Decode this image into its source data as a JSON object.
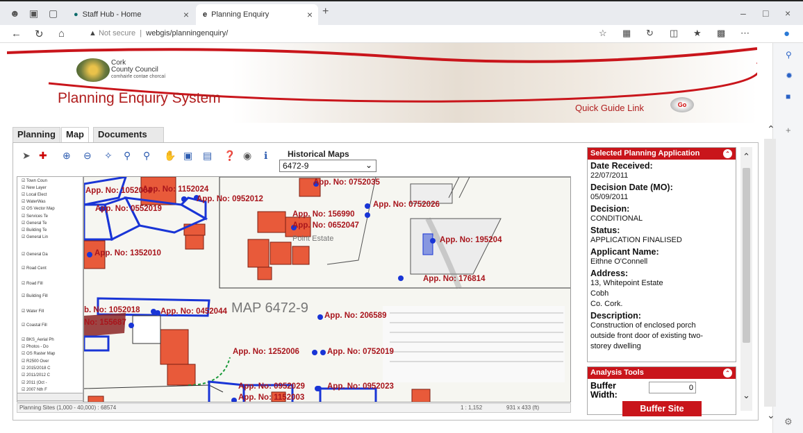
{
  "browser": {
    "tabs": [
      {
        "title": "Staff Hub - Home"
      },
      {
        "title": "Planning Enquiry"
      }
    ],
    "new_tab": "+",
    "security": "Not secure",
    "url": "webgis/planningenquiry/"
  },
  "header": {
    "org_line1": "Cork",
    "org_line2": "County Council",
    "org_irish": "comhairle contae chorcaí",
    "title": "Planning Enquiry System",
    "guide_link": "Quick Guide Link",
    "go": "Go"
  },
  "tabs": {
    "planning": "Planning",
    "map": "Map",
    "documents": "Documents"
  },
  "historical": {
    "label": "Historical Maps",
    "selected": "6472-9"
  },
  "layers": [
    "Town Coun",
    "New Layer",
    "Local Elect",
    "WaterWas",
    "OS Vector Map",
    "Services Te",
    "General Te",
    "Building Te",
    "General Lin",
    "General Da",
    "Road Cent",
    "Road Fill",
    "Building Fill",
    "Water Fill",
    "Coastal Fill",
    "BKS_Aerial Ph",
    "Photos - Do",
    "OS Raster Map",
    "R2500 Over",
    "2015/2018 C",
    "2011/2012 C",
    "2011 (Oct -",
    "2007 Nth F"
  ],
  "map": {
    "sheet_label": "MAP  6472-9",
    "estate_label": "Point Estate",
    "applications": [
      "App. No: 1052004",
      "App. No: 1152024",
      "App. No: 0552019",
      "App. No: 0952012",
      "App. No: 0752035",
      "App. No: 0752026",
      "App. No: 156990",
      "App. No: 0652047",
      "App. No: 195204",
      "App. No: 1352010",
      "App. No: 176814",
      "b. No: 1052018",
      "App. No: 0452044",
      "No: 155687",
      "App. No: 206589",
      "App. No: 1252006",
      "App. No: 0752019",
      "App. No: 0952029",
      "App. No: 0952023",
      "App. No: 1152003"
    ]
  },
  "status": {
    "left": "Planning Sites (1,000 - 40,000) : 68574",
    "scale": "1 : 1,152",
    "dims": "931 x 433 (ft)"
  },
  "selected": {
    "heading": "Selected Planning Application",
    "date_received_label": "Date Received:",
    "date_received": "22/07/2011",
    "decision_date_label": "Decision Date (MO):",
    "decision_date": "05/09/2011",
    "decision_label": "Decision:",
    "decision": "CONDITIONAL",
    "status_label": "Status:",
    "status": "APPLICATION FINALISED",
    "applicant_label": "Applicant Name:",
    "applicant": "Eithne O'Connell",
    "address_label": "Address:",
    "address1": "13, Whitepoint Estate",
    "address2": "Cobh",
    "address3": "Co. Cork.",
    "description_label": "Description:",
    "description": "Construction of enclosed porch outside front door of existing two-storey dwelling"
  },
  "analysis": {
    "heading": "Analysis Tools",
    "buffer_label": "Buffer Width:",
    "buffer_value": "0",
    "buffer_button": "Buffer Site"
  },
  "colors": {
    "brand_red": "#c9151b",
    "title_red": "#b01c1c",
    "marker_blue": "#1935d6"
  }
}
